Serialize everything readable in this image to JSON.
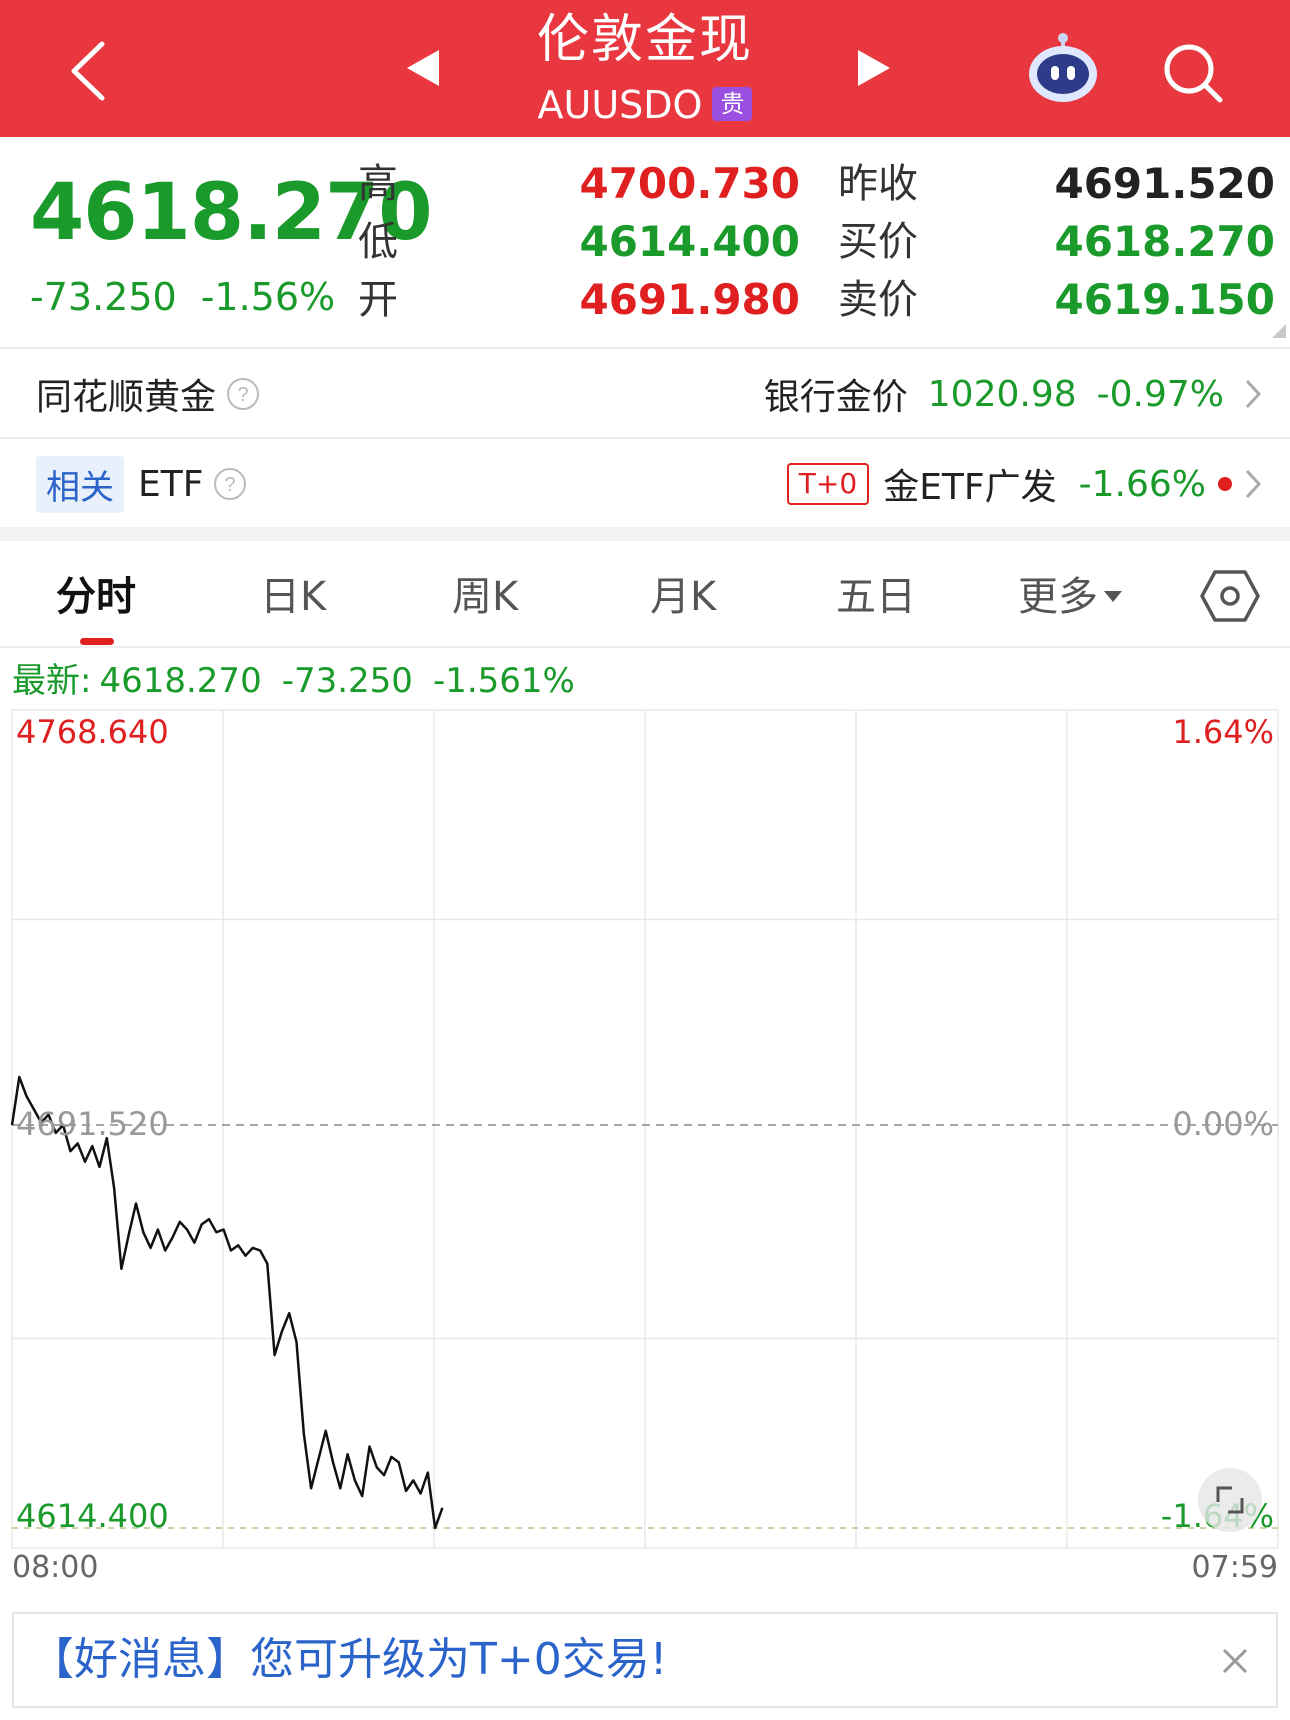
{
  "header": {
    "title": "伦敦金现",
    "code": "AUUSDO",
    "badge": "贵"
  },
  "quote": {
    "price": "4618.270",
    "change": "-73.250",
    "change_pct": "-1.56%",
    "labels_left": [
      "高",
      "低",
      "开"
    ],
    "high": "4700.730",
    "low": "4614.400",
    "open": "4691.980",
    "labels_right": [
      "昨收",
      "买价",
      "卖价"
    ],
    "prev_close": "4691.520",
    "bid": "4618.270",
    "ask": "4619.150"
  },
  "gold_row": {
    "label": "同花顺黄金",
    "bank_label": "银行金价",
    "bank_price": "1020.98",
    "bank_change": "-0.97%"
  },
  "etf_row": {
    "tag": "相关",
    "label": "ETF",
    "t0": "T+0",
    "etf_name": "金ETF广发",
    "etf_change": "-1.66%"
  },
  "tabs": [
    "分时",
    "日K",
    "周K",
    "月K",
    "五日",
    "更多"
  ],
  "latest": {
    "prefix": "最新:",
    "price": "4618.270",
    "change": "-73.250",
    "pct": "-1.561%"
  },
  "chart_data": {
    "type": "line",
    "series_color": "#111111",
    "y_max": 4768.64,
    "y_min": 4614.4,
    "y_ref": 4691.52,
    "y_labels": {
      "max": "4768.640",
      "ref": "4691.520",
      "min": "4614.400"
    },
    "pct_labels": {
      "max": "1.64%",
      "ref": "0.00%",
      "min": "-1.64%"
    },
    "ylim": [
      4614.4,
      4768.64
    ],
    "x_start": "08:00",
    "x_end": "07:59",
    "x_fraction_span": [
      0,
      0.34
    ],
    "values": [
      4691.5,
      4700.7,
      4697.0,
      4694.5,
      4692.0,
      4693.5,
      4690.0,
      4691.5,
      4686.5,
      4688.0,
      4684.5,
      4687.5,
      4683.5,
      4689.0,
      4679.5,
      4664.0,
      4670.5,
      4676.5,
      4671.0,
      4668.0,
      4671.5,
      4667.5,
      4670.0,
      4673.0,
      4671.5,
      4669.0,
      4672.5,
      4673.5,
      4671.0,
      4671.5,
      4667.5,
      4668.5,
      4666.5,
      4668.0,
      4667.5,
      4665.0,
      4647.5,
      4652.0,
      4655.5,
      4650.0,
      4632.5,
      4622.0,
      4627.5,
      4633.0,
      4627.0,
      4622.0,
      4628.5,
      4623.5,
      4620.5,
      4630.0,
      4626.0,
      4624.5,
      4628.0,
      4627.0,
      4621.5,
      4623.5,
      4621.0,
      4625.0,
      4614.4,
      4618.27
    ]
  },
  "banner": {
    "text": "【好消息】您可升级为T+0交易!"
  }
}
